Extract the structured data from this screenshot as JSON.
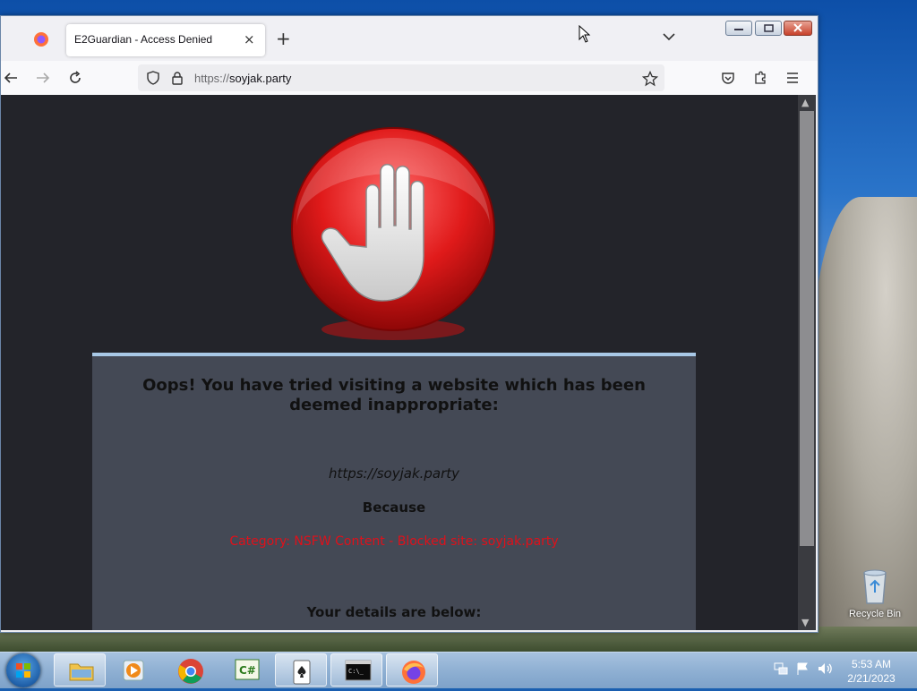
{
  "browser": {
    "tab": {
      "title": "E2Guardian - Access Denied",
      "close_symbol": "×"
    },
    "new_tab_symbol": "+",
    "url": {
      "protocol": "https://",
      "host": "soyjak.party"
    }
  },
  "page": {
    "heading": "Oops! You have tried visiting a website which has been deemed inappropriate:",
    "blocked_url": "https://soyjak.party",
    "because_label": "Because",
    "reason": "Category: NSFW Content - Blocked site: soyjak.party",
    "details_label": "Your details are below:"
  },
  "desktop": {
    "recycle_bin_label": "Recycle Bin"
  },
  "taskbar": {
    "items": [
      "file-explorer",
      "media-player",
      "chrome",
      "csharp-ide",
      "solitaire",
      "command-prompt",
      "firefox"
    ],
    "clock": {
      "time": "5:53 AM",
      "date": "2/21/2023"
    }
  },
  "colors": {
    "page_background": "#23242a",
    "panel_background": "#444955",
    "reason_text": "#e0101a"
  }
}
